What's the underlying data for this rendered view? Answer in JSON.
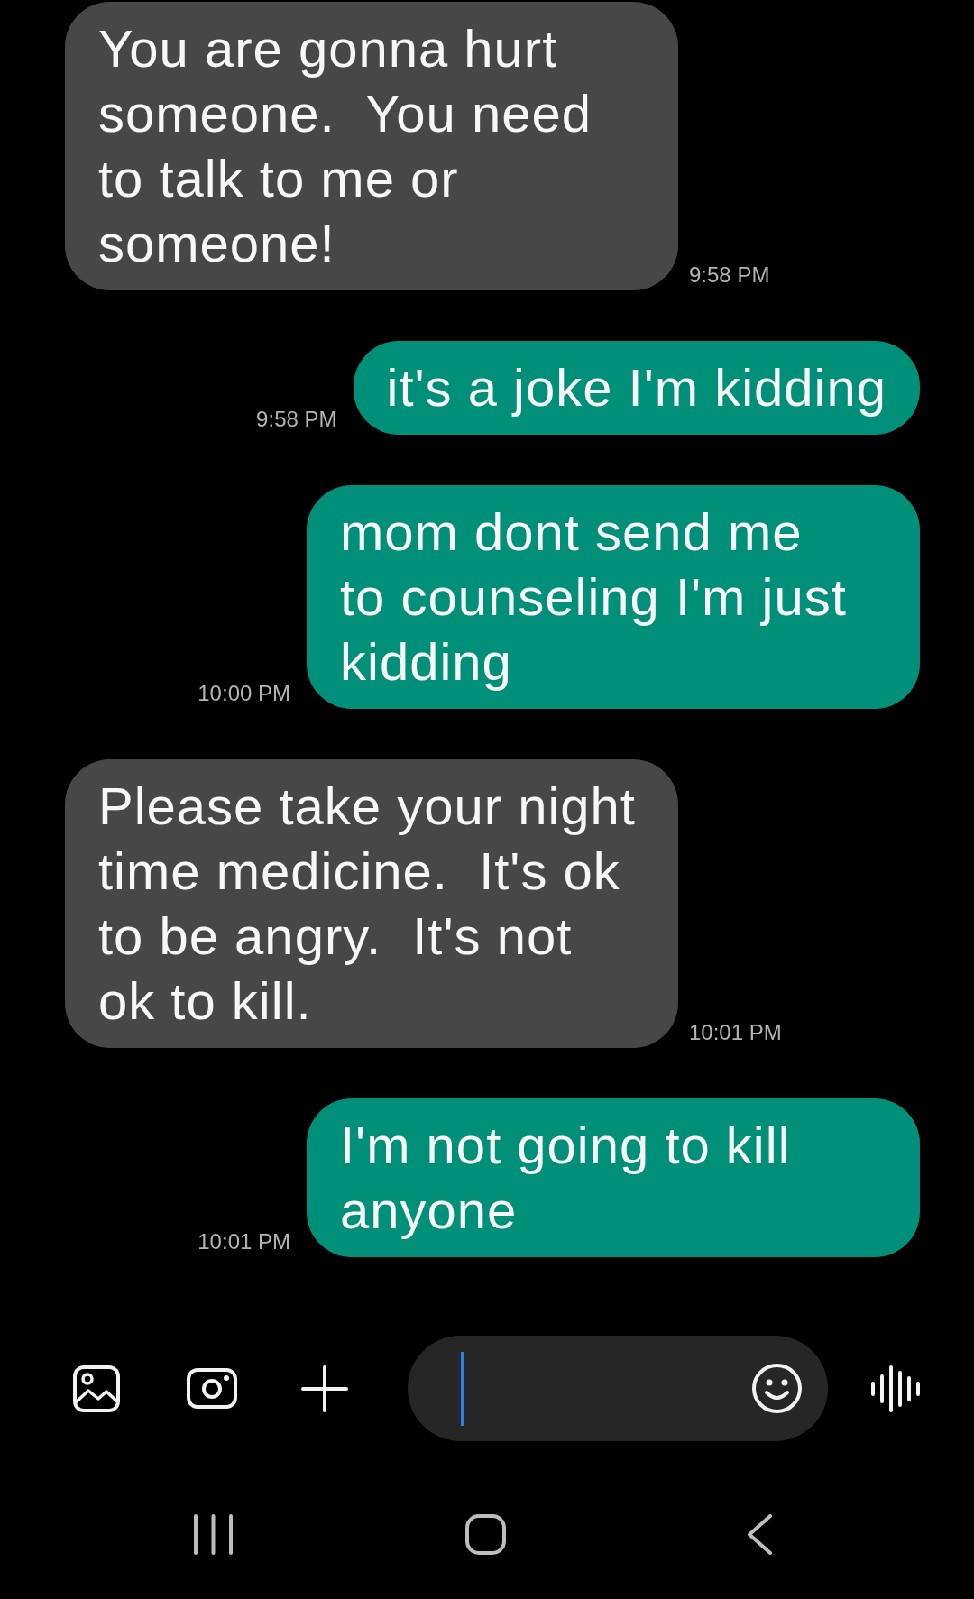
{
  "messages": [
    {
      "kind": "received",
      "text": "You are gonna hurt\nsomeone.  You need\nto talk to me or\nsomeone!",
      "time": "9:58 PM"
    },
    {
      "kind": "sent",
      "text": "it's a joke I'm kidding",
      "time": "9:58 PM"
    },
    {
      "kind": "sent",
      "text": "mom dont send me\nto counseling I'm just\nkidding",
      "time": "10:00 PM"
    },
    {
      "kind": "received",
      "text": "Please take your night\ntime medicine.  It's ok\nto be angry.  It's not\nok to kill.",
      "time": "10:01 PM"
    },
    {
      "kind": "sent",
      "text": "I'm not going to kill\nanyone",
      "time": "10:01 PM"
    }
  ],
  "message_field": {
    "focused": true
  }
}
